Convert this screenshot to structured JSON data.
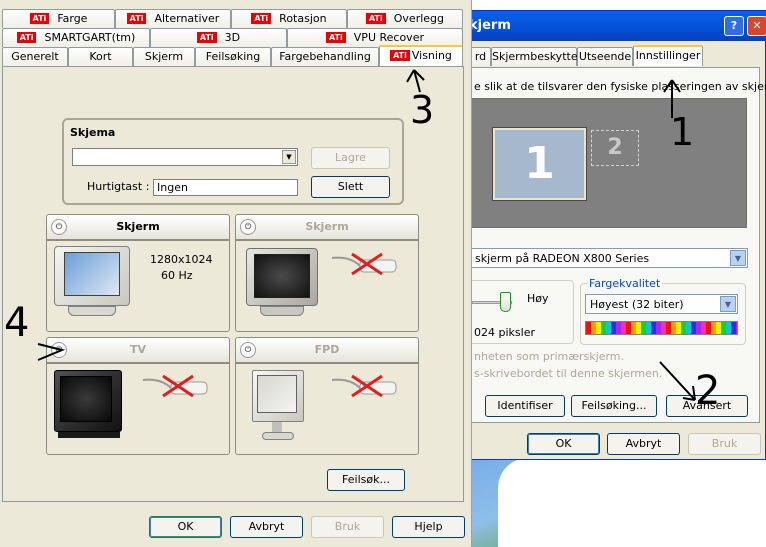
{
  "left_dialog": {
    "tabs_row1": [
      "Farge",
      "Alternativer",
      "Rotasjon",
      "Overlegg"
    ],
    "tabs_row2": [
      "SMARTGART(tm)",
      "3D",
      "VPU Recover"
    ],
    "tabs_row3": [
      "Generelt",
      "Kort",
      "Skjerm",
      "Feilsøking",
      "Fargebehandling",
      "Visning"
    ],
    "badge": "ATi",
    "scheme": {
      "title": "Skjema",
      "save_label": "Lagre",
      "hotkey_label": "Hurtigtast :",
      "hotkey_value": "Ingen",
      "delete_label": "Slett"
    },
    "displays": [
      {
        "name": "Skjerm",
        "info1": "1280x1024",
        "info2": "60 Hz",
        "active": true
      },
      {
        "name": "Skjerm",
        "active": false
      },
      {
        "name": "TV",
        "active": false
      },
      {
        "name": "FPD",
        "active": false
      }
    ],
    "troubleshoot_label": "Feilsøk...",
    "ok_label": "OK",
    "cancel_label": "Avbryt",
    "apply_label": "Bruk",
    "help_label": "Hjelp"
  },
  "right_dialog": {
    "title_fragment": "kjerm",
    "help_btn": "?",
    "close_btn": "✕",
    "tabs": [
      "rd",
      "Skjermbeskytter",
      "Utseende",
      "Innstillinger"
    ],
    "instruction": "e slik at de tilsvarer den fysiske plasseringen av skjermene.",
    "monitor1": "1",
    "monitor2": "2",
    "display_select": "skjerm på RADEON X800 Series",
    "resolution_high": "Høy",
    "resolution_value": "024 piksler",
    "color_quality_label": "Fargekvalitet",
    "color_quality_value": "Høyest (32 biter)",
    "check1": "nheten som primærskjerm.",
    "check2": "s-skrivebordet til denne skjermen.",
    "identify_label": "Identifiser",
    "troubleshoot_label": "Feilsøking...",
    "advanced_label": "Avansert",
    "ok_label": "OK",
    "cancel_label": "Avbryt",
    "apply_label": "Bruk"
  },
  "annotations": [
    "3",
    "1",
    "4",
    "2"
  ]
}
